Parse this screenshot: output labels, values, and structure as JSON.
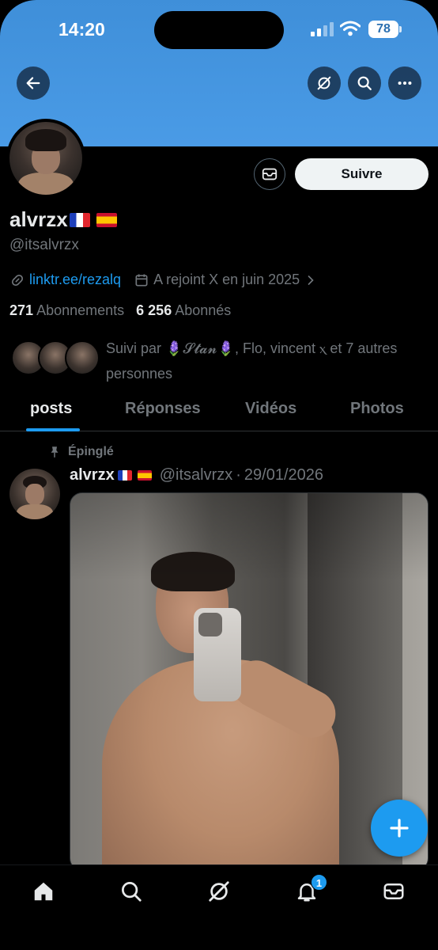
{
  "status_bar": {
    "time": "14:20",
    "battery": "78"
  },
  "header": {
    "back_icon": "arrow-left-icon",
    "grok_icon": "grok-icon",
    "search_icon": "search-icon",
    "more_icon": "more-icon"
  },
  "profile": {
    "name": "alvrzx",
    "flags": [
      "france",
      "spain"
    ],
    "handle": "@itsalvrzx",
    "link": "linktr.ee/rezalq",
    "joined": "A rejoint X en juin 2025",
    "following_count": "271",
    "following_label": "Abonnements",
    "followers_count": "6 256",
    "followers_label": "Abonnés",
    "followed_by": "Suivi par 🪻𝓢𝓽𝓪𝓷🪻, Flo, vincent ⲭ et 7 autres personnes",
    "follow_label": "Suivre"
  },
  "tabs": [
    {
      "label": "posts",
      "active": true
    },
    {
      "label": "Réponses",
      "active": false
    },
    {
      "label": "Vidéos",
      "active": false
    },
    {
      "label": "Photos",
      "active": false
    }
  ],
  "post": {
    "pinned_label": "Épinglé",
    "name": "alvrzx",
    "handle": "@itsalvrzx",
    "separator": "·",
    "date": "29/01/2026"
  },
  "bottom_nav": {
    "items": [
      "home-icon",
      "search-icon",
      "grok-icon",
      "bell-icon",
      "mail-icon"
    ],
    "notification_count": "1"
  },
  "colors": {
    "accent": "#1d9bf0",
    "banner": "#4a9be6",
    "background": "#000000"
  }
}
